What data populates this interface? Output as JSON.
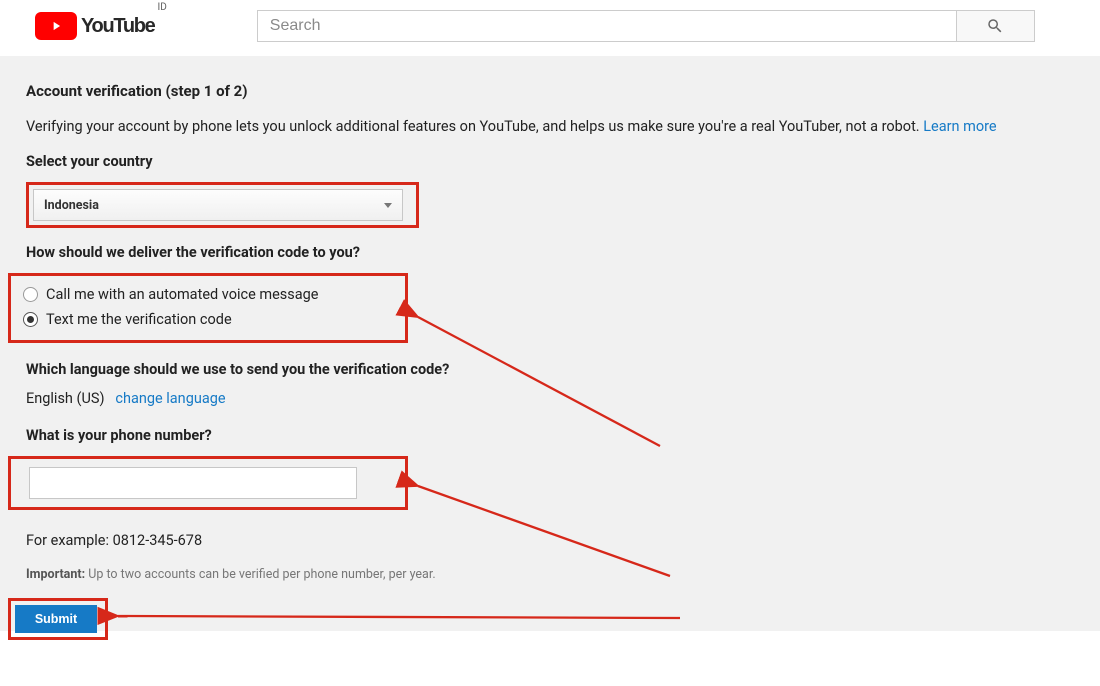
{
  "header": {
    "brand": "YouTube",
    "region_code": "ID",
    "search_placeholder": "Search"
  },
  "page": {
    "title": "Account verification (step 1 of 2)",
    "description": "Verifying your account by phone lets you unlock additional features on YouTube, and helps us make sure you're a real YouTuber, not a robot. ",
    "learn_more": "Learn more",
    "country_label": "Select your country",
    "country_selected": "Indonesia",
    "delivery_label": "How should we deliver the verification code to you?",
    "radio_call": "Call me with an automated voice message",
    "radio_text": "Text me the verification code",
    "language_label": "Which language should we use to send you the verification code?",
    "language_current": "English (US)",
    "change_language": "change language",
    "phone_label": "What is your phone number?",
    "phone_value": "",
    "example": "For example: 0812-345-678",
    "important_prefix": "Important:",
    "important_text": " Up to two accounts can be verified per phone number, per year.",
    "submit": "Submit"
  }
}
